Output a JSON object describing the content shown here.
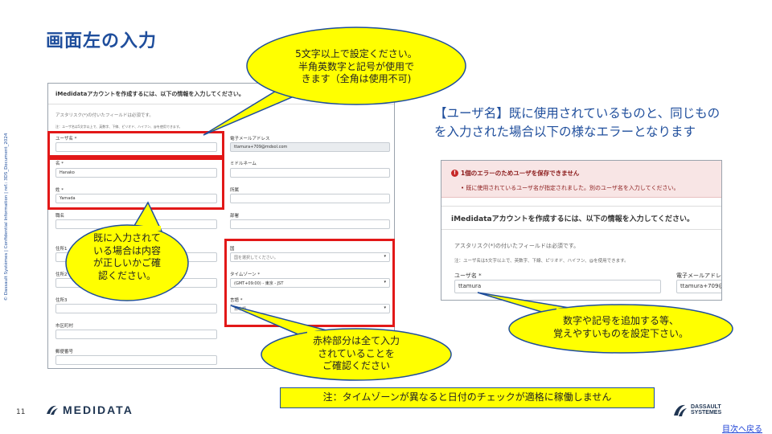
{
  "slide": {
    "title": "画面左の入力",
    "vertical_note": "© Dassault Systèmes | Confidential Information | ref.: 3DS_Document_2024",
    "page_number": "11",
    "back_link": "目次へ戻る",
    "medidata_logo": "MEDIDATA",
    "ds_logo_line1": "DASSAULT",
    "ds_logo_line2": "SYSTEMES"
  },
  "left_form": {
    "header": "iMedidataアカウントを作成するには、以下の情報を入力してください。",
    "required_note": "アスタリスク(*)の付いたフィールドは必須です。",
    "username_hint": "注：ユーザ名は5文字以上で、英数字、下線、ピリオド、ハイフン、@を使用できます。",
    "username_label": "ユーザ名 *",
    "username_value": "",
    "email_label": "電子メールアドレス",
    "email_value": "ttamura+709@mdsol.com",
    "first_name_label": "名 *",
    "first_name_value": "Hanako",
    "middle_name_label": "ミドルネーム",
    "last_name_label": "姓 *",
    "last_name_value": "Yamada",
    "dept_label": "所属",
    "title_label": "職名",
    "position_label": "部署",
    "address1_label": "住所1",
    "address2_label": "住所2",
    "address3_label": "住所3",
    "city_label": "市区町村",
    "postal_label": "郵便番号",
    "country_label": "国",
    "country_placeholder": "国を選択してください。",
    "timezone_label": "タイムゾーン *",
    "timezone_value": "(GMT+09:00) - 東京 - JST",
    "language_label": "言語 *",
    "language_value": "日本語"
  },
  "right_form": {
    "error_title": "1個のエラーのためユーザを保存できません",
    "error_message": "既に使用されているユーザ名が指定されました。別のユーザ名を入力してください。",
    "header": "iMedidataアカウントを作成するには、以下の情報を入力してください。",
    "required_note": "アスタリスク(*)の付いたフィールドは必須です。",
    "username_hint": "注：ユーザ名は5文字以上で、英数字、下線、ピリオド、ハイフン、@を使用できます。",
    "username_label": "ユーザ名 *",
    "username_value": "ttamura",
    "email_label": "電子メールアドレ",
    "email_value": "ttamura+709@m"
  },
  "callouts": {
    "top_line1": "5文字以上で設定ください。",
    "top_line2": "半角英数字と記号が使用で",
    "top_line3": "きます（全角は使用不可)",
    "left_line1": "既に入力されて",
    "left_line2": "いる場合は内容",
    "left_line3": "が正しいかご確",
    "left_line4": "認ください。",
    "mid_line1": "赤枠部分は全て入力",
    "mid_line2": "されていることを",
    "mid_line3": "ご確認ください",
    "right_line1": "数字や記号を追加する等、",
    "right_line2": "覚えやすいものを設定下さい。"
  },
  "right_text": {
    "line1": "【ユーザ名】既に使用されているものと、同じもの",
    "line2": "を入力された場合以下の様なエラーとなります"
  },
  "note": "注：タイムゾーンが異なると日付のチェックが適格に稼働しません",
  "colors": {
    "title_blue": "#1f4e9c",
    "callout_yellow": "#ffff00",
    "red_frame": "#e21818"
  }
}
